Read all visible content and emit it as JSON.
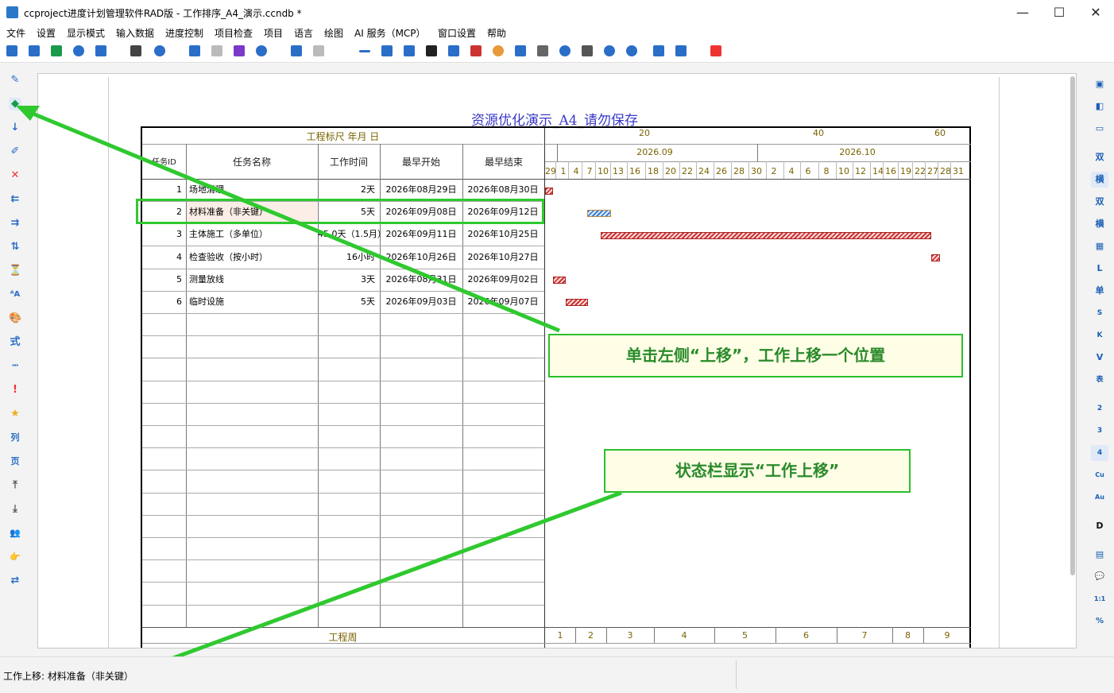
{
  "window": {
    "title": "ccproject进度计划管理软件RAD版 - 工作排序_A4_演示.ccndb *"
  },
  "menu": [
    "文件",
    "设置",
    "显示模式",
    "输入数据",
    "进度控制",
    "项目检查",
    "项目",
    "语言",
    "绘图",
    "AI 服务（MCP）",
    "窗口设置",
    "帮助"
  ],
  "left_tools": [
    "✎",
    "◆",
    "↓",
    "✐",
    "✕",
    "⇇",
    "⇉",
    "⇅",
    "⏳",
    "ᴬA",
    "🎨",
    "式",
    "┅",
    "!",
    "★",
    "列",
    "页",
    "⤒",
    "⤓",
    "👥",
    "👉",
    "⇄"
  ],
  "right_tools": [
    "▣",
    "◧",
    "▭",
    "双",
    "横",
    "双",
    "横",
    "▦",
    "L",
    "单",
    "S",
    "K",
    "V",
    "表",
    "2",
    "3",
    "4",
    "Cu",
    "Au",
    "D",
    "▤",
    "💬",
    "1:1",
    "%"
  ],
  "doc": {
    "title": "资源优化演示_A4_请勿保存",
    "scale_label": "工程标尺 年月 日",
    "columns": [
      "任务ID",
      "任务名称",
      "工作时间",
      "最早开始",
      "最早结束"
    ],
    "scale_numbers": [
      "20",
      "40",
      "60"
    ],
    "months": [
      "2026.09",
      "2026.10"
    ],
    "days": [
      "29",
      "1",
      "4",
      "7",
      "10",
      "13",
      "16",
      "18",
      "20",
      "22",
      "24",
      "26",
      "28",
      "30",
      "2",
      "4",
      "6",
      "8",
      "10",
      "12",
      "14",
      "16",
      "19",
      "22",
      "27",
      "28",
      "31"
    ],
    "tasks": [
      {
        "id": "1",
        "name": "场地清理",
        "duration": "2天",
        "start": "2026年08月29日",
        "end": "2026年08月30日"
      },
      {
        "id": "2",
        "name": "材料准备（非关键）",
        "duration": "5天",
        "start": "2026年09月08日",
        "end": "2026年09月12日"
      },
      {
        "id": "3",
        "name": "主体施工（多单位）",
        "duration": "45.0天（1.5月）",
        "start": "2026年09月11日",
        "end": "2026年10月25日"
      },
      {
        "id": "4",
        "name": "检查验收（按小时）",
        "duration": "16小时",
        "start": "2026年10月26日",
        "end": "2026年10月27日"
      },
      {
        "id": "5",
        "name": "测量放线",
        "duration": "3天",
        "start": "2026年08月31日",
        "end": "2026年09月02日"
      },
      {
        "id": "6",
        "name": "临时设施",
        "duration": "5天",
        "start": "2026年09月03日",
        "end": "2026年09月07日"
      }
    ],
    "week_label": "工程周",
    "weeks": [
      "1",
      "2",
      "3",
      "4",
      "5",
      "6",
      "7",
      "8",
      "9"
    ]
  },
  "callouts": {
    "move_up": "单击左侧“上移”，工作上移一个位置",
    "status": "状态栏显示“工作上移”"
  },
  "statusbar": {
    "text": "工作上移: 材料准备（非关键）"
  },
  "colors": {
    "accent_green": "#2fc92f",
    "bar_red": "#c33333",
    "bar_blue": "#3a7fd0"
  }
}
